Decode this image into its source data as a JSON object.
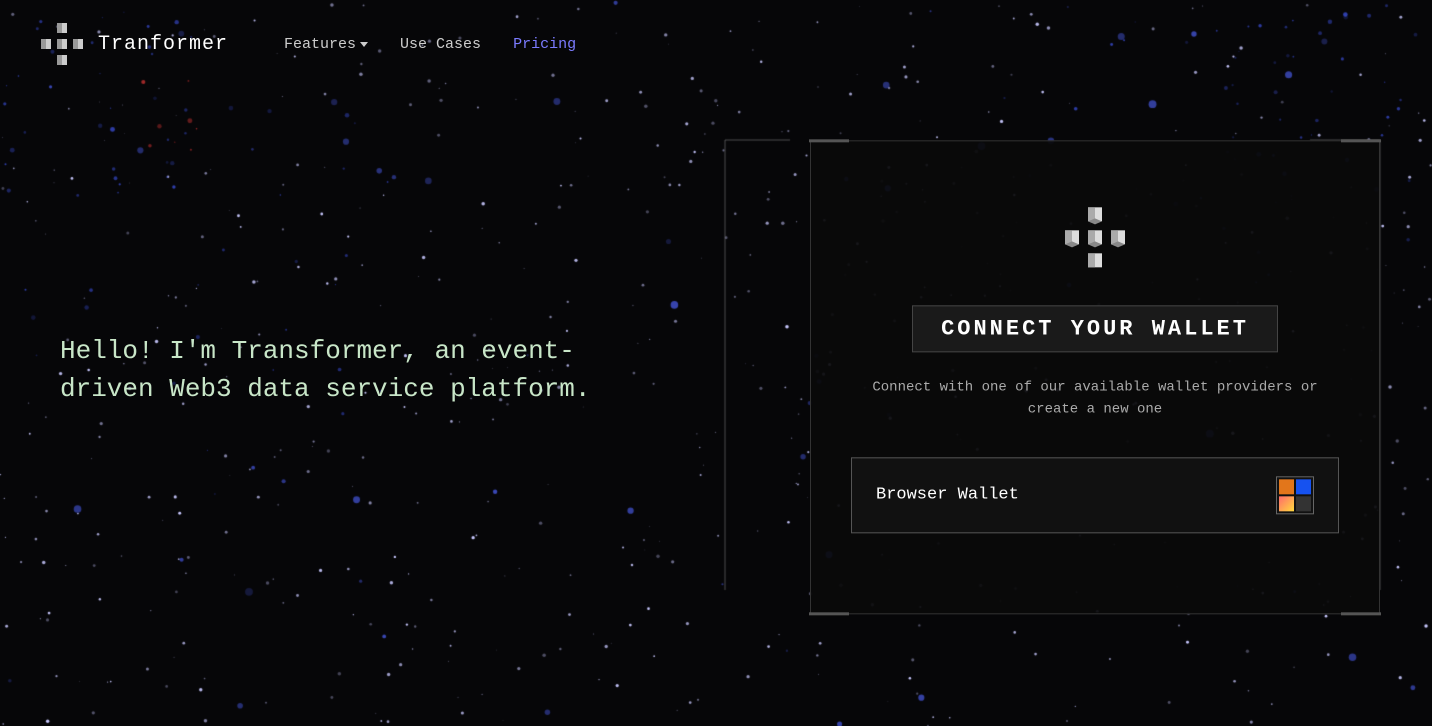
{
  "brand": {
    "name": "Tranformer",
    "logo_alt": "Transformer logo"
  },
  "nav": {
    "links": [
      {
        "id": "features",
        "label": "Features",
        "has_dropdown": true,
        "active": false
      },
      {
        "id": "use-cases",
        "label": "Use Cases",
        "has_dropdown": false,
        "active": false
      },
      {
        "id": "pricing",
        "label": "Pricing",
        "has_dropdown": false,
        "active": true
      }
    ]
  },
  "hero": {
    "text": "Hello! I'm Transformer, an event-driven Web3 data service platform."
  },
  "connect_panel": {
    "title": "CONNECT YOUR WALLET",
    "subtitle": "Connect with one of our available wallet providers or create a new one",
    "wallet_button_label": "Browser Wallet"
  }
}
